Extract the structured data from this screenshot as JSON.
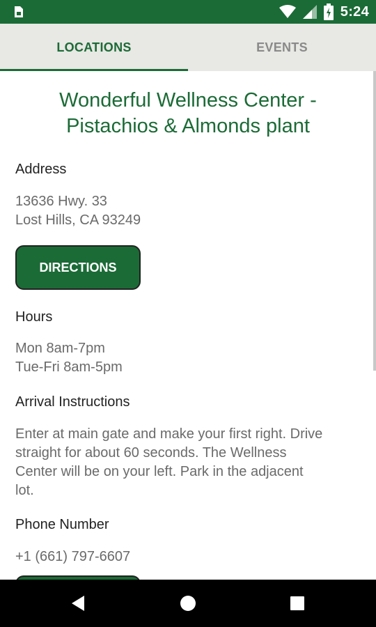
{
  "status_bar": {
    "time": "5:24",
    "icons": [
      "sim-card-icon",
      "wifi-icon",
      "signal-icon",
      "battery-charging-icon"
    ]
  },
  "tabs": [
    {
      "label": "LOCATIONS",
      "active": true
    },
    {
      "label": "EVENTS",
      "active": false
    }
  ],
  "location": {
    "name_line1": "Wonderful Wellness Center -",
    "name_line2": "Pistachios & Almonds plant",
    "address_label": "Address",
    "address_line1": "13636 Hwy. 33",
    "address_line2": "Lost Hills, CA 93249",
    "directions_label": "DIRECTIONS",
    "hours_label": "Hours",
    "hours_line1": "Mon 8am-7pm",
    "hours_line2": "Tue-Fri 8am-5pm",
    "arrival_label": "Arrival Instructions",
    "arrival_line1": "Enter at main gate and make your first right. Drive",
    "arrival_line2": "straight for about 60 seconds. The Wellness",
    "arrival_line3": "Center will be on your left. Park in the adjacent",
    "arrival_line4": "lot.",
    "phone_label": "Phone Number",
    "phone_value": "+1 (661) 797-6607"
  },
  "colors": {
    "brand_green": "#1b6b36",
    "tab_bar_bg": "#e8e8e4",
    "text_dark": "#222222",
    "text_muted": "#6a6a6a"
  },
  "nav_bar": {
    "icons": [
      "back-icon",
      "home-icon",
      "recents-icon"
    ]
  }
}
